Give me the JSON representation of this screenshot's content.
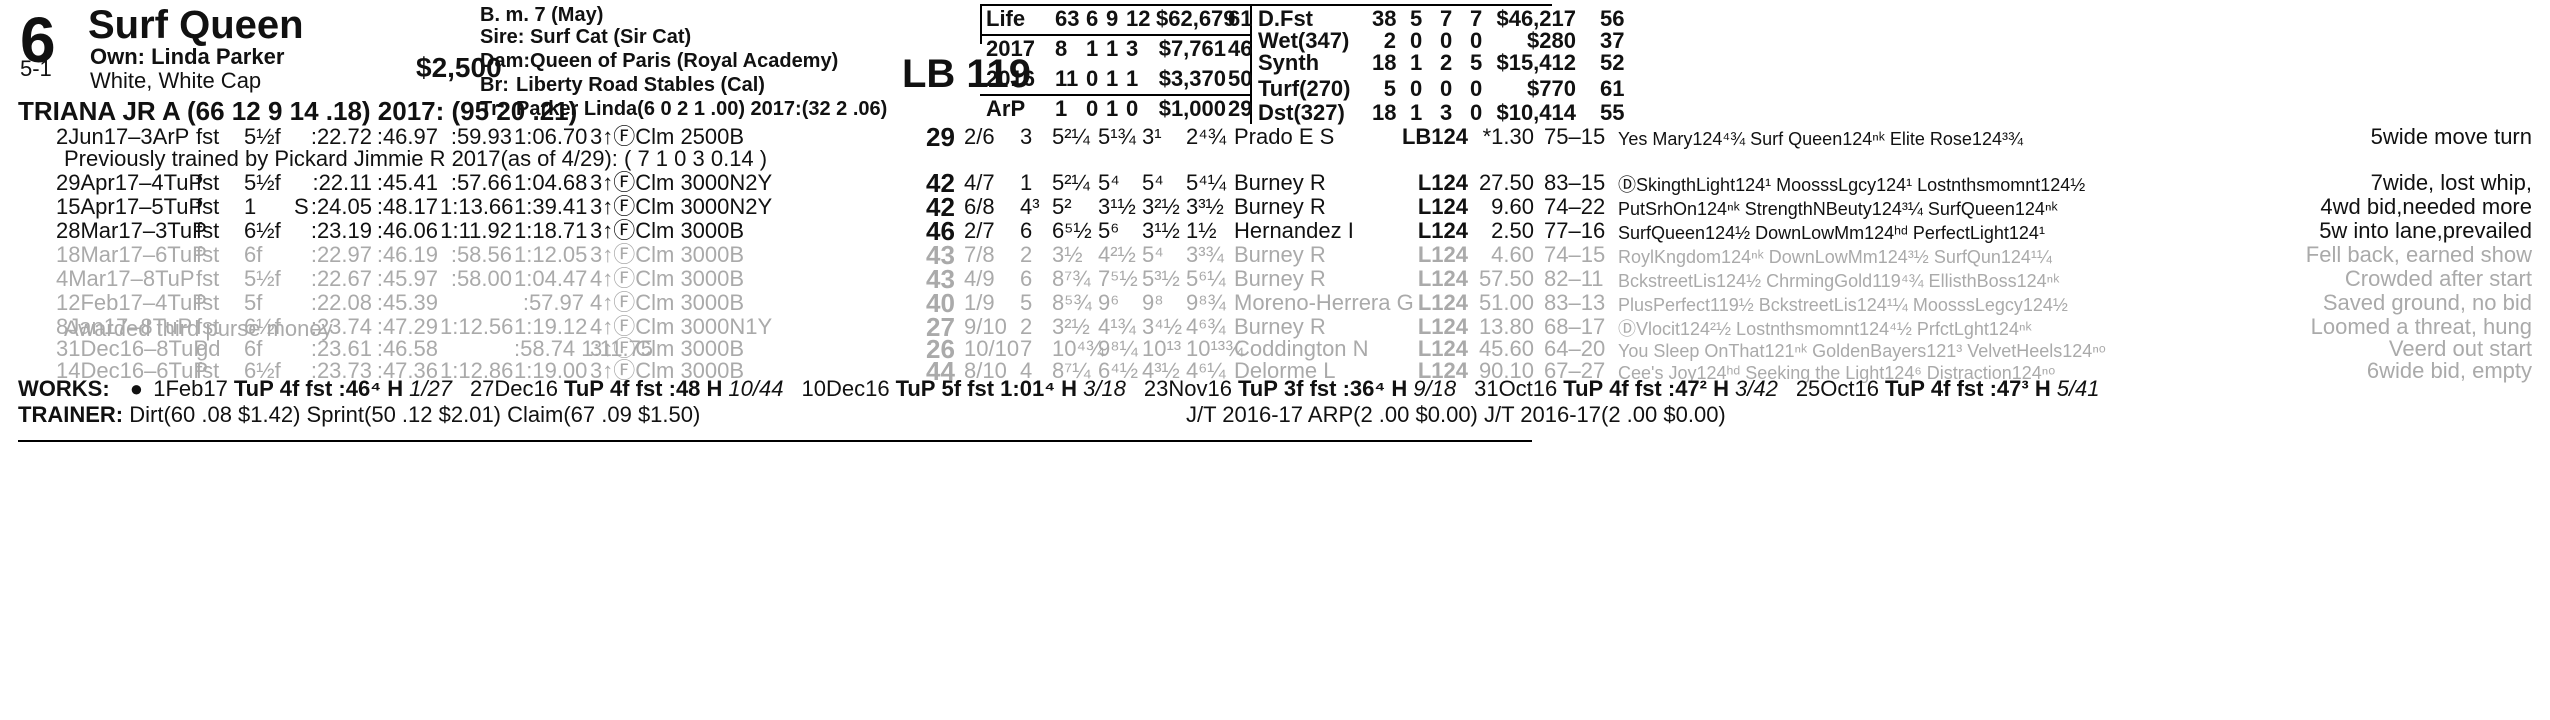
{
  "horse": {
    "program_number": "6",
    "name": "Surf Queen",
    "odds": "5-1",
    "owner": "Own: Linda Parker",
    "silks": "White, White Cap",
    "claim_price": "$2,500",
    "jockey_line": "TRIANA JR A (66 12 9 14 .18) 2017: (95 20 .21)",
    "sex_age": "B. m. 7 (May)",
    "sire": "Sire: Surf Cat (Sir Cat)",
    "dam": "Dam:Queen of Paris (Royal Academy)",
    "breeder_label": "Br:",
    "breeder": "Liberty Road Stables (Cal)",
    "trainer_label": "Tr:",
    "trainer": "Parker Linda(6 0 2 1 .00)  2017:(32 2 .06)",
    "weight": "LB 119"
  },
  "record_left": [
    {
      "label": "Life",
      "starts": "63",
      "w": "6",
      "p": "9",
      "s": "12",
      "earn": "$62,679",
      "speed": "61"
    },
    {
      "label": "2017",
      "starts": "8",
      "w": "1",
      "p": "1",
      "s": "3",
      "earn": "$7,761",
      "speed": "46"
    },
    {
      "label": "2016",
      "starts": "11",
      "w": "0",
      "p": "1",
      "s": "1",
      "earn": "$3,370",
      "speed": "50"
    },
    {
      "label": "ArP",
      "starts": "1",
      "w": "0",
      "p": "1",
      "s": "0",
      "earn": "$1,000",
      "speed": "29"
    }
  ],
  "record_right": [
    {
      "label": "D.Fst",
      "starts": "38",
      "w": "5",
      "p": "7",
      "s": "7",
      "earn": "$46,217",
      "speed": "56"
    },
    {
      "label": "Wet(347)",
      "starts": "2",
      "w": "0",
      "p": "0",
      "s": "0",
      "earn": "$280",
      "speed": "37"
    },
    {
      "label": "Synth",
      "starts": "18",
      "w": "1",
      "p": "2",
      "s": "5",
      "earn": "$15,412",
      "speed": "52"
    },
    {
      "label": "Turf(270)",
      "starts": "5",
      "w": "0",
      "p": "0",
      "s": "0",
      "earn": "$770",
      "speed": "61"
    },
    {
      "label": "Dst(327)",
      "starts": "18",
      "w": "1",
      "p": "3",
      "s": "0",
      "earn": "$10,414",
      "speed": "55"
    }
  ],
  "past_performances": [
    {
      "date": "2Jun17–3ArP",
      "track": "fst",
      "dist": "5½f",
      "surf": "",
      "f1": ":22.72",
      "f2": ":46.97",
      "f3": ":59.93",
      "f4": "1:06.70",
      "race": "3↑ⒻClm 2500B",
      "bsf": "29",
      "pp": "2/6",
      "st": "3",
      "c1": "5²¼",
      "c2": "5¹¾",
      "str": "3¹",
      "fin": "2⁴¾",
      "jockey": "Prado E S",
      "med": "LB124",
      "odds": "*1.30",
      "pace": "75–15",
      "comp": "Yes Mary124⁴¾ Surf Queen124ⁿᵏ Elite Rose124³¾",
      "comment": "5wide move turn",
      "faded": false
    },
    {
      "date": "29Apr17–4TuP",
      "track": "fst",
      "dist": "5½f",
      "surf": "",
      "f1": ":22.11",
      "f2": ":45.41",
      "f3": ":57.66",
      "f4": "1:04.68",
      "race": "3↑ⒻClm 3000N2Y",
      "bsf": "42",
      "pp": "4/7",
      "st": "1",
      "c1": "5²¼",
      "c2": "5⁴",
      "str": "5⁴",
      "fin": "5⁴¼",
      "jockey": "Burney R",
      "med": "L124",
      "odds": "27.50",
      "pace": "83–15",
      "comp": "ⒹSkingthLight124¹ MoosssLgcy124¹ Lostnthsmomnt124½",
      "comment": "7wide, lost whip,",
      "faded": false
    },
    {
      "date": "15Apr17–5TuP",
      "track": "fst",
      "dist": "1",
      "surf": "S",
      "f1": ":24.05",
      "f2": ":48.17",
      "f3": "1:13.66",
      "f4": "1:39.41",
      "race": "3↑ⒻClm 3000N2Y",
      "bsf": "42",
      "pp": "6/8",
      "st": "4³",
      "c1": "5²",
      "c2": "3¹½",
      "str": "3²½",
      "fin": "3³½",
      "jockey": "Burney R",
      "med": "L124",
      "odds": "9.60",
      "pace": "74–22",
      "comp": "PutSrhOn124ⁿᵏ StrengthNBeuty124³¼ SurfQueen124ⁿᵏ",
      "comment": "4wd bid,needed more",
      "faded": false
    },
    {
      "date": "28Mar17–3TuP",
      "track": "fst",
      "dist": "6½f",
      "surf": "",
      "f1": ":23.19",
      "f2": ":46.06",
      "f3": "1:11.92",
      "f4": "1:18.71",
      "race": "3↑ⒻClm 3000B",
      "bsf": "46",
      "pp": "2/7",
      "st": "6",
      "c1": "6⁵½",
      "c2": "5⁶",
      "str": "3¹½",
      "fin": "1½",
      "jockey": "Hernandez I",
      "med": "L124",
      "odds": "2.50",
      "pace": "77–16",
      "comp": "SurfQueen124½ DownLowMm124ʰᵈ PerfectLight124¹",
      "comment": "5w into lane,prevailed",
      "faded": false
    },
    {
      "date": "18Mar17–6TuP",
      "track": "fst",
      "dist": "6f",
      "surf": "",
      "f1": ":22.97",
      "f2": ":46.19",
      "f3": ":58.56",
      "f4": "1:12.05",
      "race": "3↑ⒻClm 3000B",
      "bsf": "43",
      "pp": "7/8",
      "st": "2",
      "c1": "3½",
      "c2": "4²½",
      "str": "5⁴",
      "fin": "3³¾",
      "jockey": "Burney R",
      "med": "L124",
      "odds": "4.60",
      "pace": "74–15",
      "comp": "RoylKngdom124ⁿᵏ DownLowMm124³½ SurfQun124¹¼",
      "comment": "Fell back, earned show",
      "faded": true
    },
    {
      "date": "4Mar17–8TuP",
      "track": "fst",
      "dist": "5½f",
      "surf": "",
      "f1": ":22.67",
      "f2": ":45.97",
      "f3": ":58.00",
      "f4": "1:04.47",
      "race": "4↑ⒻClm 3000B",
      "bsf": "43",
      "pp": "4/9",
      "st": "6",
      "c1": "8⁷¾",
      "c2": "7⁵½",
      "str": "5³½",
      "fin": "5⁶¼",
      "jockey": "Burney R",
      "med": "L124",
      "odds": "57.50",
      "pace": "82–11",
      "comp": "BckstreetLis124½ ChrmingGold119⁴¾ EllisthBoss124ⁿᵏ",
      "comment": "Crowded after start",
      "faded": true
    },
    {
      "date": "12Feb17–4TuP",
      "track": "fst",
      "dist": "5f",
      "surf": "",
      "f1": ":22.08",
      "f2": ":45.39",
      "f3": "",
      "f4": ":57.97",
      "race": "4↑ⒻClm 3000B",
      "bsf": "40",
      "pp": "1/9",
      "st": "5",
      "c1": "8⁵¾",
      "c2": "9⁶",
      "str": "9⁸",
      "fin": "9⁸¾",
      "jockey": "Moreno-Herrera G",
      "med": "L124",
      "odds": "51.00",
      "pace": "83–13",
      "comp": "PlusPerfect119½ BckstreetLis124¹¼ MoosssLegcy124½",
      "comment": "Saved ground, no bid",
      "faded": true
    },
    {
      "date": "8Jan17–8TuP",
      "track": "fst",
      "dist": "6½f",
      "surf": "",
      "f1": ":23.74",
      "f2": ":47.29",
      "f3": "1:12.56",
      "f4": "1:19.12",
      "race": "4↑ⒻClm 3000N1Y",
      "bsf": "27",
      "pp": "9/10",
      "st": "2",
      "c1": "3²½",
      "c2": "4¹¾",
      "str": "3⁴½",
      "fin": "4⁶¾",
      "jockey": "Burney R",
      "med": "L124",
      "odds": "13.80",
      "pace": "68–17",
      "comp": "ⒹVlocit124²½ Lostnthsmomnt124⁴½ PrfctLght124ⁿᵏ",
      "comment": "Loomed a threat, hung",
      "faded": true
    },
    {
      "date": "31Dec16–8TuP",
      "track": "gd",
      "dist": "6f",
      "surf": "",
      "f1": ":23.61",
      "f2": ":46.58",
      "f3": "",
      "f4": ":58.74 1:11.75",
      "race": "3↑ⒻClm 3000B",
      "bsf": "26",
      "pp": "10/10",
      "st": "7",
      "c1": "10⁴¾",
      "c2": "9⁸¼",
      "str": "10¹³",
      "fin": "10¹³¾",
      "jockey": "Coddington N",
      "med": "L124",
      "odds": "45.60",
      "pace": "64–20",
      "comp": "You Sleep OnThat121ⁿᵏ GoldenBayers121³ VelvetHeels124ⁿᵒ",
      "comment": "Veerd out start",
      "faded": true
    },
    {
      "date": "14Dec16–6TuP",
      "track": "fst",
      "dist": "6½f",
      "surf": "",
      "f1": ":23.73",
      "f2": ":47.36",
      "f3": "1:12.86",
      "f4": "1:19.00",
      "race": "3↑ⒻClm 3000B",
      "bsf": "44",
      "pp": "8/10",
      "st": "4",
      "c1": "8⁷¼",
      "c2": "6⁴½",
      "str": "4³½",
      "fin": "4⁶¼",
      "jockey": "Delorme L",
      "med": "L124",
      "odds": "90.10",
      "pace": "67–27",
      "comp": "Cee's Joy124ʰᵈ Seeking the Light124⁶ Distraction124ⁿᵒ",
      "comment": "6wide bid, empty",
      "faded": true
    }
  ],
  "notes": {
    "previous_trainer": "Previously trained by Pickard Jimmie R 2017(as of 4/29): ( 7 1 0 3 0.14 )",
    "awarded": "Awarded third purse money"
  },
  "works": {
    "label": "WORKS:",
    "bullet": "●",
    "items": [
      {
        "date": "1Feb17",
        "track": "TuP",
        "desc": "4f fst :46⁴ H",
        "rank": "1/27"
      },
      {
        "date": "27Dec16",
        "track": "TuP",
        "desc": "4f fst :48 H",
        "rank": "10/44"
      },
      {
        "date": "10Dec16",
        "track": "TuP",
        "desc": "5f fst 1:01⁴ H",
        "rank": "3/18"
      },
      {
        "date": "23Nov16",
        "track": "TuP",
        "desc": "3f fst :36⁴ H",
        "rank": "9/18"
      },
      {
        "date": "31Oct16",
        "track": "TuP",
        "desc": "4f fst :47² H",
        "rank": "3/42"
      },
      {
        "date": "25Oct16",
        "track": "TuP",
        "desc": "4f fst :47³ H",
        "rank": "5/41"
      }
    ]
  },
  "trainer_stats": {
    "label": "TRAINER:",
    "text": "Dirt(60 .08 $1.42) Sprint(50 .12 $2.01) Claim(67 .09 $1.50)",
    "jt": "J/T 2016-17 ARP(2 .00 $0.00)  J/T 2016-17(2 .00 $0.00)"
  }
}
